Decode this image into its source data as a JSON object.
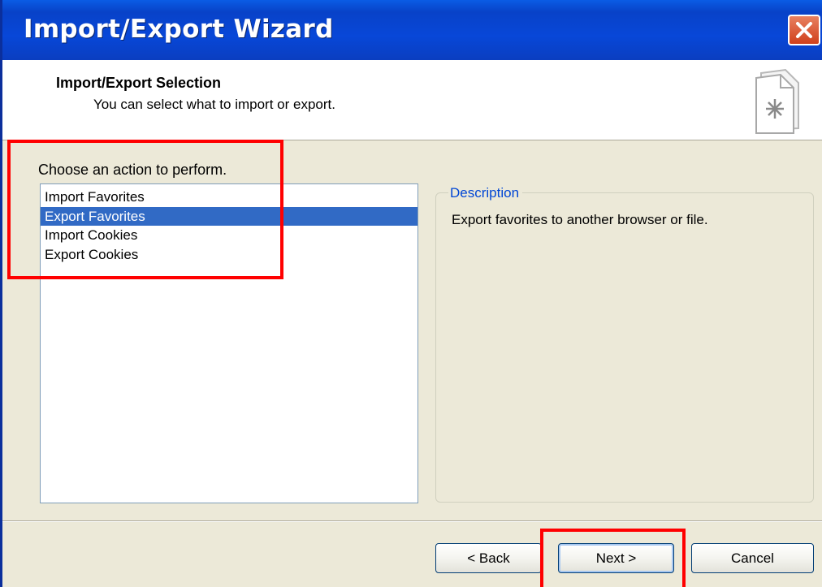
{
  "window": {
    "title": "Import/Export Wizard",
    "close_icon": "close-icon"
  },
  "header": {
    "title": "Import/Export Selection",
    "subtitle": "You can select what to import or export.",
    "icon": "wizard-page-icon"
  },
  "actions": {
    "label": "Choose an action to perform.",
    "items": [
      {
        "label": "Import Favorites",
        "selected": false
      },
      {
        "label": "Export Favorites",
        "selected": true
      },
      {
        "label": "Import Cookies",
        "selected": false
      },
      {
        "label": "Export Cookies",
        "selected": false
      }
    ]
  },
  "description": {
    "legend": "Description",
    "text": "Export favorites to another browser or file."
  },
  "buttons": {
    "back": "< Back",
    "next": "Next >",
    "cancel": "Cancel"
  },
  "colors": {
    "titlebar": "#0842c8",
    "selection": "#316ac5",
    "annotation": "#ff0000",
    "legend_text": "#0046d5"
  }
}
